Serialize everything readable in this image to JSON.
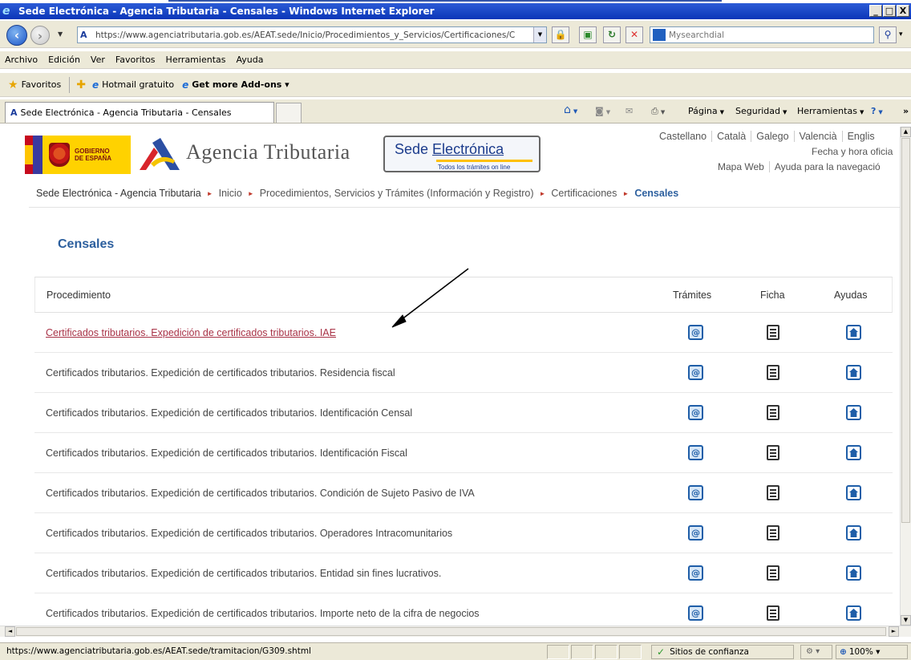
{
  "window": {
    "title": "Sede Electrónica - Agencia Tributaria - Censales - Windows Internet Explorer",
    "controls": [
      "_",
      "□",
      "X"
    ]
  },
  "address_bar": {
    "url": "https://www.agenciatributaria.gob.es/AEAT.sede/Inicio/Procedimientos_y_Servicios/Certificaciones/C",
    "search_placeholder": "Mysearchdial"
  },
  "menu": {
    "items": [
      "Archivo",
      "Edición",
      "Ver",
      "Favoritos",
      "Herramientas",
      "Ayuda"
    ]
  },
  "favorites_bar": {
    "label": "Favoritos",
    "links": [
      "Hotmail gratuito",
      "Get more Add-ons"
    ]
  },
  "tab": {
    "label": "Sede Electrónica - Agencia Tributaria - Censales"
  },
  "command_bar": {
    "page": "Página",
    "safety": "Seguridad",
    "tools": "Herramientas",
    "more": "»"
  },
  "site_header": {
    "gov_logo_text": [
      "GOBIERNO",
      "DE ESPAÑA"
    ],
    "agency_name": "Agencia Tributaria",
    "sede_title_prefix": "Sede ",
    "sede_title_link": "Electrónica",
    "sede_subtitle": "Todos los trámites on line",
    "languages": [
      "Castellano",
      "Català",
      "Galego",
      "Valencià",
      "Englis"
    ],
    "date_label": "Fecha y hora oficia",
    "tool_links": [
      "Mapa Web",
      "Ayuda para la navegació"
    ]
  },
  "breadcrumb": {
    "items": [
      "Sede Electrónica - Agencia Tributaria",
      "Inicio",
      "Procedimientos, Servicios y Trámites (Información y Registro)",
      "Certificaciones"
    ],
    "current": "Censales"
  },
  "page": {
    "title": "Censales"
  },
  "table": {
    "headers": {
      "procedimiento": "Procedimiento",
      "tramites": "Trámites",
      "ficha": "Ficha",
      "ayudas": "Ayudas"
    },
    "rows": [
      {
        "label": "Certificados tributarios. Expedición de certificados tributarios. IAE",
        "visited": true
      },
      {
        "label": "Certificados tributarios. Expedición de certificados tributarios. Residencia fiscal",
        "visited": false
      },
      {
        "label": "Certificados tributarios. Expedición de certificados tributarios. Identificación Censal",
        "visited": false
      },
      {
        "label": "Certificados tributarios. Expedición de certificados tributarios. Identificación Fiscal",
        "visited": false
      },
      {
        "label": "Certificados tributarios. Expedición de certificados tributarios. Condición de Sujeto Pasivo de IVA",
        "visited": false
      },
      {
        "label": "Certificados tributarios. Expedición de certificados tributarios. Operadores Intracomunitarios",
        "visited": false
      },
      {
        "label": "Certificados tributarios. Expedición de certificados tributarios. Entidad sin fines lucrativos.",
        "visited": false
      },
      {
        "label": "Certificados tributarios. Expedición de certificados tributarios. Importe neto de la cifra de negocios",
        "visited": false
      }
    ]
  },
  "status_bar": {
    "url": "https://www.agenciatributaria.gob.es/AEAT.sede/tramitacion/G309.shtml",
    "zone": "Sitios de confianza",
    "zoom": "100%"
  },
  "colors": {
    "titlebar": "#0a36b8",
    "link_blue": "#2c5f9e",
    "visited_link": "#a83246",
    "icon_blue": "#1f5ea8"
  }
}
